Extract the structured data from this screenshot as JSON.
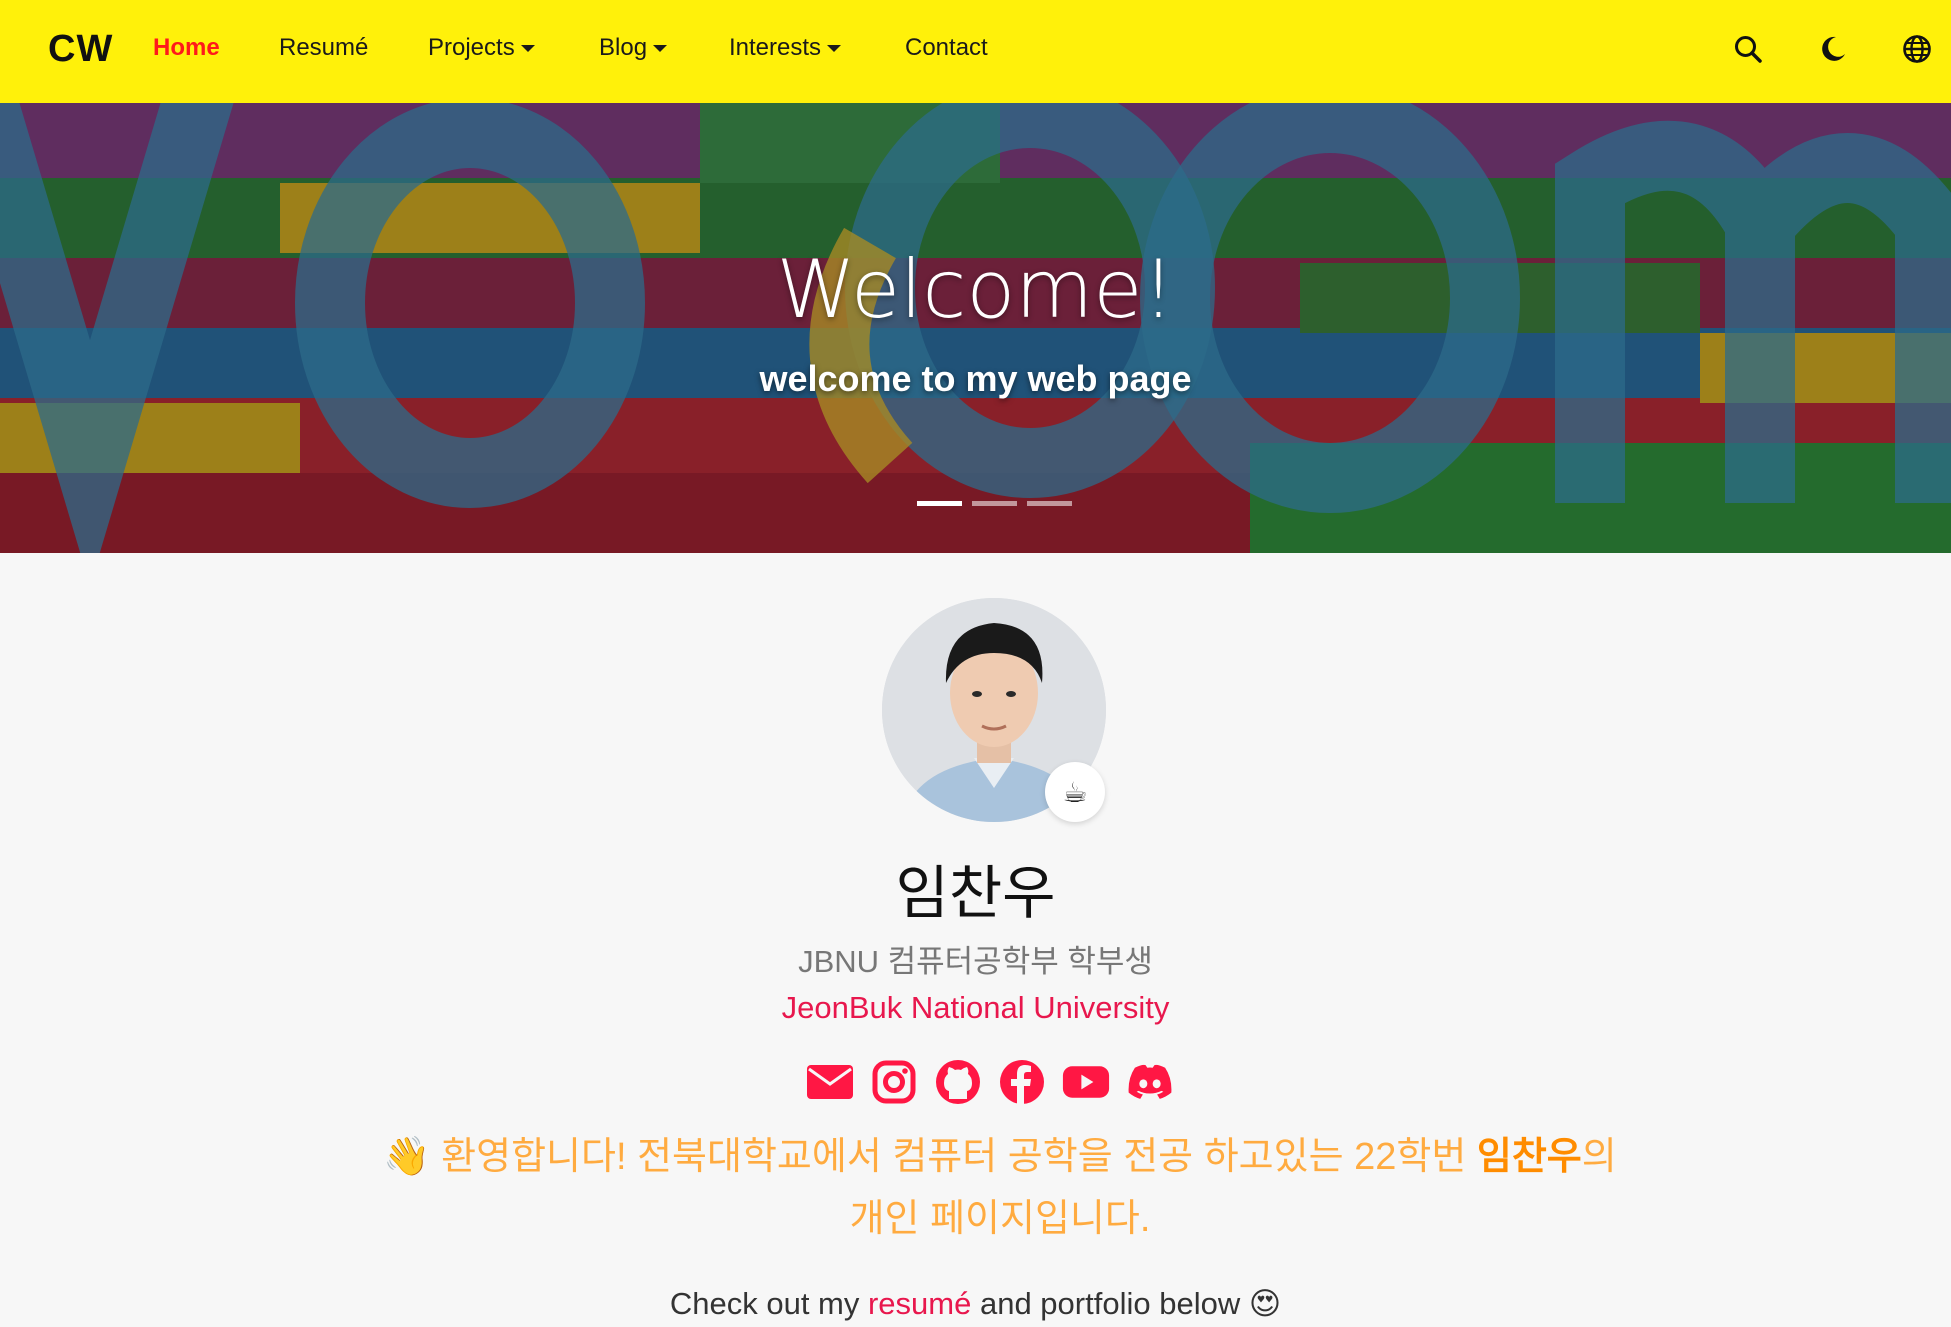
{
  "nav": {
    "brand": "CW",
    "items": [
      {
        "label": "Home",
        "active": true,
        "dropdown": false
      },
      {
        "label": "Resumé",
        "active": false,
        "dropdown": false
      },
      {
        "label": "Projects",
        "active": false,
        "dropdown": true
      },
      {
        "label": "Blog",
        "active": false,
        "dropdown": true
      },
      {
        "label": "Interests",
        "active": false,
        "dropdown": true
      },
      {
        "label": "Contact",
        "active": false,
        "dropdown": false
      }
    ],
    "icons": [
      "search-icon",
      "moon-icon",
      "globe-icon"
    ]
  },
  "hero": {
    "title": "Welcome!",
    "subtitle": "welcome to my web page",
    "slides": 3,
    "active_slide": 1
  },
  "profile": {
    "status_emoji": "☕",
    "name": "임찬우",
    "role": "JBNU 컴퓨터공학부 학부생",
    "organization": "JeonBuk National University",
    "socials": [
      "email-icon",
      "instagram-icon",
      "github-icon",
      "facebook-icon",
      "youtube-icon",
      "discord-icon"
    ],
    "welcome_prefix": "👋 환영합니다! 전북대학교에서 컴퓨터 공학을 전공 하고있는 22학번 ",
    "welcome_name": "임찬우",
    "welcome_suffix": "의 개인 페이지입니다.",
    "checkout_prefix": "Check out my ",
    "checkout_link": "resumé",
    "checkout_suffix": " and portfolio below 😍"
  },
  "colors": {
    "nav_bg": "#fff10a",
    "accent": "#e8174d",
    "active_nav": "#ff1a1a",
    "welcome_text": "#ffab40"
  }
}
